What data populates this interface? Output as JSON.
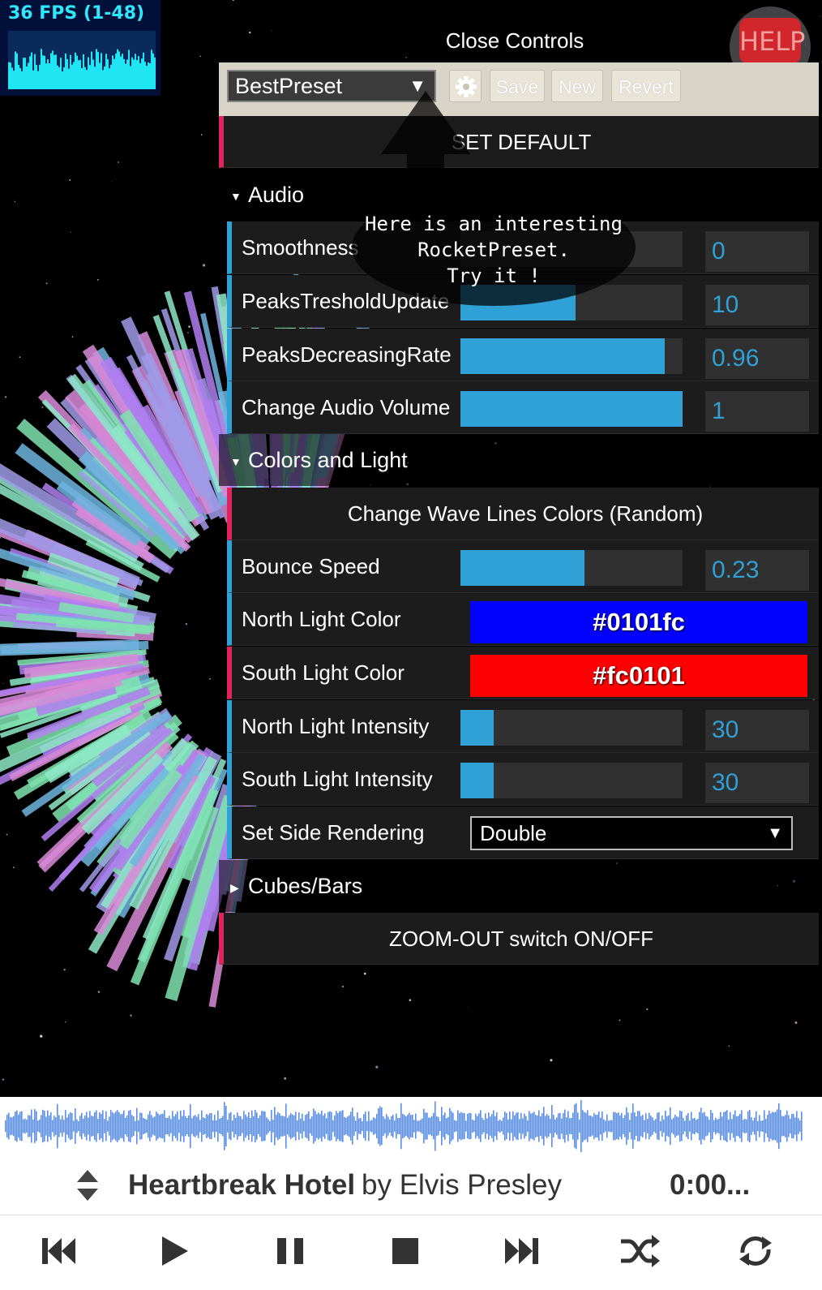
{
  "stats": {
    "fps_label": "36 FPS (1-48)"
  },
  "help": {
    "label": "HELP"
  },
  "controls": {
    "close_label": "Close Controls"
  },
  "preset_bar": {
    "selected": "BestPreset",
    "save_label": "Save",
    "new_label": "New",
    "revert_label": "Revert"
  },
  "set_default_label": "SET DEFAULT",
  "audio": {
    "title": "Audio",
    "smoothness": {
      "label": "Smoothness",
      "value": "0",
      "fraction": 0
    },
    "peaks_threshold": {
      "label": "PeaksTresholdUpdate",
      "value": "10",
      "fraction": 0.52
    },
    "peaks_decreasing": {
      "label": "PeaksDecreasingRate",
      "value": "0.96",
      "fraction": 0.92
    },
    "volume": {
      "label": "Change Audio Volume",
      "value": "1",
      "fraction": 1
    }
  },
  "colors": {
    "title": "Colors and Light",
    "wave_lines_label": "Change Wave Lines Colors (Random)",
    "bounce_speed": {
      "label": "Bounce Speed",
      "value": "0.23",
      "fraction": 0.56
    },
    "north_color": {
      "label": "North Light Color",
      "value": "#0101fc"
    },
    "south_color": {
      "label": "South Light Color",
      "value": "#fc0101"
    },
    "north_intensity": {
      "label": "North Light Intensity",
      "value": "30",
      "fraction": 0.15
    },
    "south_intensity": {
      "label": "South Light Intensity",
      "value": "30",
      "fraction": 0.15
    },
    "side_rendering": {
      "label": "Set Side Rendering",
      "value": "Double"
    }
  },
  "cubes": {
    "title": "Cubes/Bars"
  },
  "zoom_label": "ZOOM-OUT switch ON/OFF",
  "tooltip": {
    "text": "Here is an interesting\nRocketPreset.\nTry it !"
  },
  "player": {
    "title": "Heartbreak Hotel",
    "by": "by Elvis Presley",
    "time": "0:00..."
  },
  "theme": {
    "accent_blue": "#2fa1d6",
    "accent_pink": "#e0245e",
    "wave_blue": "#5b8fe6"
  }
}
